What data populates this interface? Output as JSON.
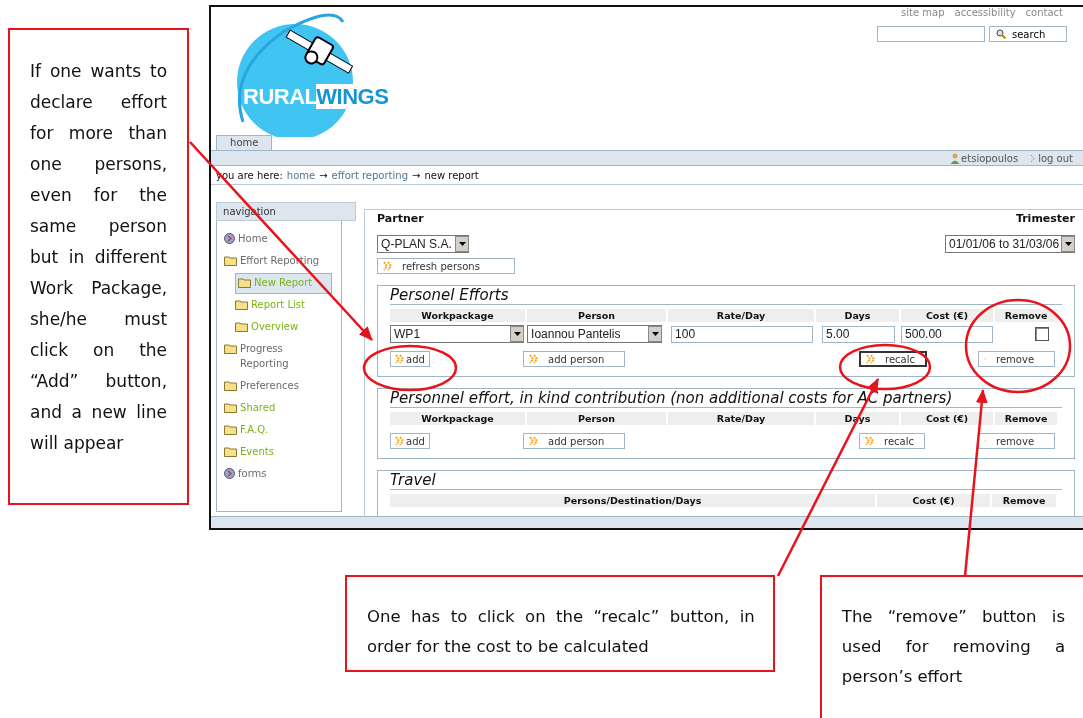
{
  "callouts": [
    {
      "text": "If one wants to declare effort for more than one persons, even for the same person but in different Work Package, she/he must click on the “Add” button, and a new line will appear"
    },
    {
      "text": "One has to click on the “recalc” button, in order for the cost to be calculated"
    },
    {
      "text": "The “remove” button is used for removing a person’s effort"
    }
  ],
  "top_links": [
    "site map",
    "accessibility",
    "contact"
  ],
  "search": {
    "button": "search"
  },
  "logo": {
    "parts": [
      "RURAL",
      "WINGS"
    ]
  },
  "tabs": [
    {
      "label": "home",
      "selected": true
    }
  ],
  "user": {
    "name": "etsiopoulos",
    "logout": "log out"
  },
  "breadcrumb": {
    "prefix": "you are here:",
    "links": [
      {
        "label": "home",
        "separator": "→"
      },
      {
        "label": "effort reporting",
        "separator": "→"
      }
    ],
    "current": "new report"
  },
  "navigation": {
    "title": "navigation",
    "items": [
      {
        "label": "Home",
        "kind": "globe",
        "color": "#6b6b6b",
        "selected": false
      },
      {
        "label": "Effort Reporting",
        "kind": "folder",
        "color": "#6b6b6b",
        "selected": false,
        "children": [
          {
            "label": "New Report",
            "kind": "folder",
            "color": "#7ab317",
            "selected": true
          },
          {
            "label": "Report List",
            "kind": "folder",
            "color": "#7ab317",
            "selected": false
          },
          {
            "label": "Overview",
            "kind": "folder",
            "color": "#7ab317",
            "selected": false
          }
        ]
      },
      {
        "label": "Progress Reporting",
        "kind": "folder",
        "color": "#6b6b6b",
        "selected": false
      },
      {
        "label": "Preferences",
        "kind": "folder",
        "color": "#6b6b6b",
        "selected": false
      },
      {
        "label": "Shared",
        "kind": "folder",
        "color": "#7ab317",
        "selected": false
      },
      {
        "label": "F.A.Q.",
        "kind": "folder",
        "color": "#7ab317",
        "selected": false
      },
      {
        "label": "Events",
        "kind": "folder",
        "color": "#7ab317",
        "selected": false
      },
      {
        "label": "forms",
        "kind": "globe",
        "color": "#6b6b6b",
        "selected": false
      }
    ]
  },
  "partner": {
    "label": "Partner",
    "value": "Q-PLAN S.A.",
    "refresh": "refresh persons"
  },
  "trimester": {
    "label": "Trimester",
    "value": "01/01/06 to 31/03/06"
  },
  "sections": [
    {
      "title": "Personel Efforts",
      "kind": "people",
      "columns": [
        "Workpackage",
        "Person",
        "Rate/Day",
        "Days",
        "Cost (€)",
        "Remove"
      ],
      "rows": [
        {
          "workpackage": "WP1",
          "person": "Ioannou Pantelis",
          "rate": "100",
          "days": "5.00",
          "cost": "500.00",
          "checked": false
        }
      ],
      "buttons": [
        {
          "label": "add",
          "focused": false
        },
        {
          "label": "add person",
          "focused": false
        },
        {
          "label": "recalc",
          "focused": true
        },
        {
          "label": "remove",
          "focused": false
        }
      ]
    },
    {
      "title": "Personnel effort, in kind contribution (non additional costs for AC partners)",
      "kind": "people",
      "columns": [
        "Workpackage",
        "Person",
        "Rate/Day",
        "Days",
        "Cost (€)",
        "Remove"
      ],
      "buttons": [
        {
          "label": "add",
          "focused": false
        },
        {
          "label": "add person",
          "focused": false
        },
        {
          "label": "recalc",
          "focused": false
        },
        {
          "label": "remove",
          "focused": false
        }
      ]
    },
    {
      "title": "Travel",
      "kind": "travel",
      "columns": [
        "Persons/Destination/Days",
        "Cost (€)",
        "Remove"
      ]
    }
  ]
}
